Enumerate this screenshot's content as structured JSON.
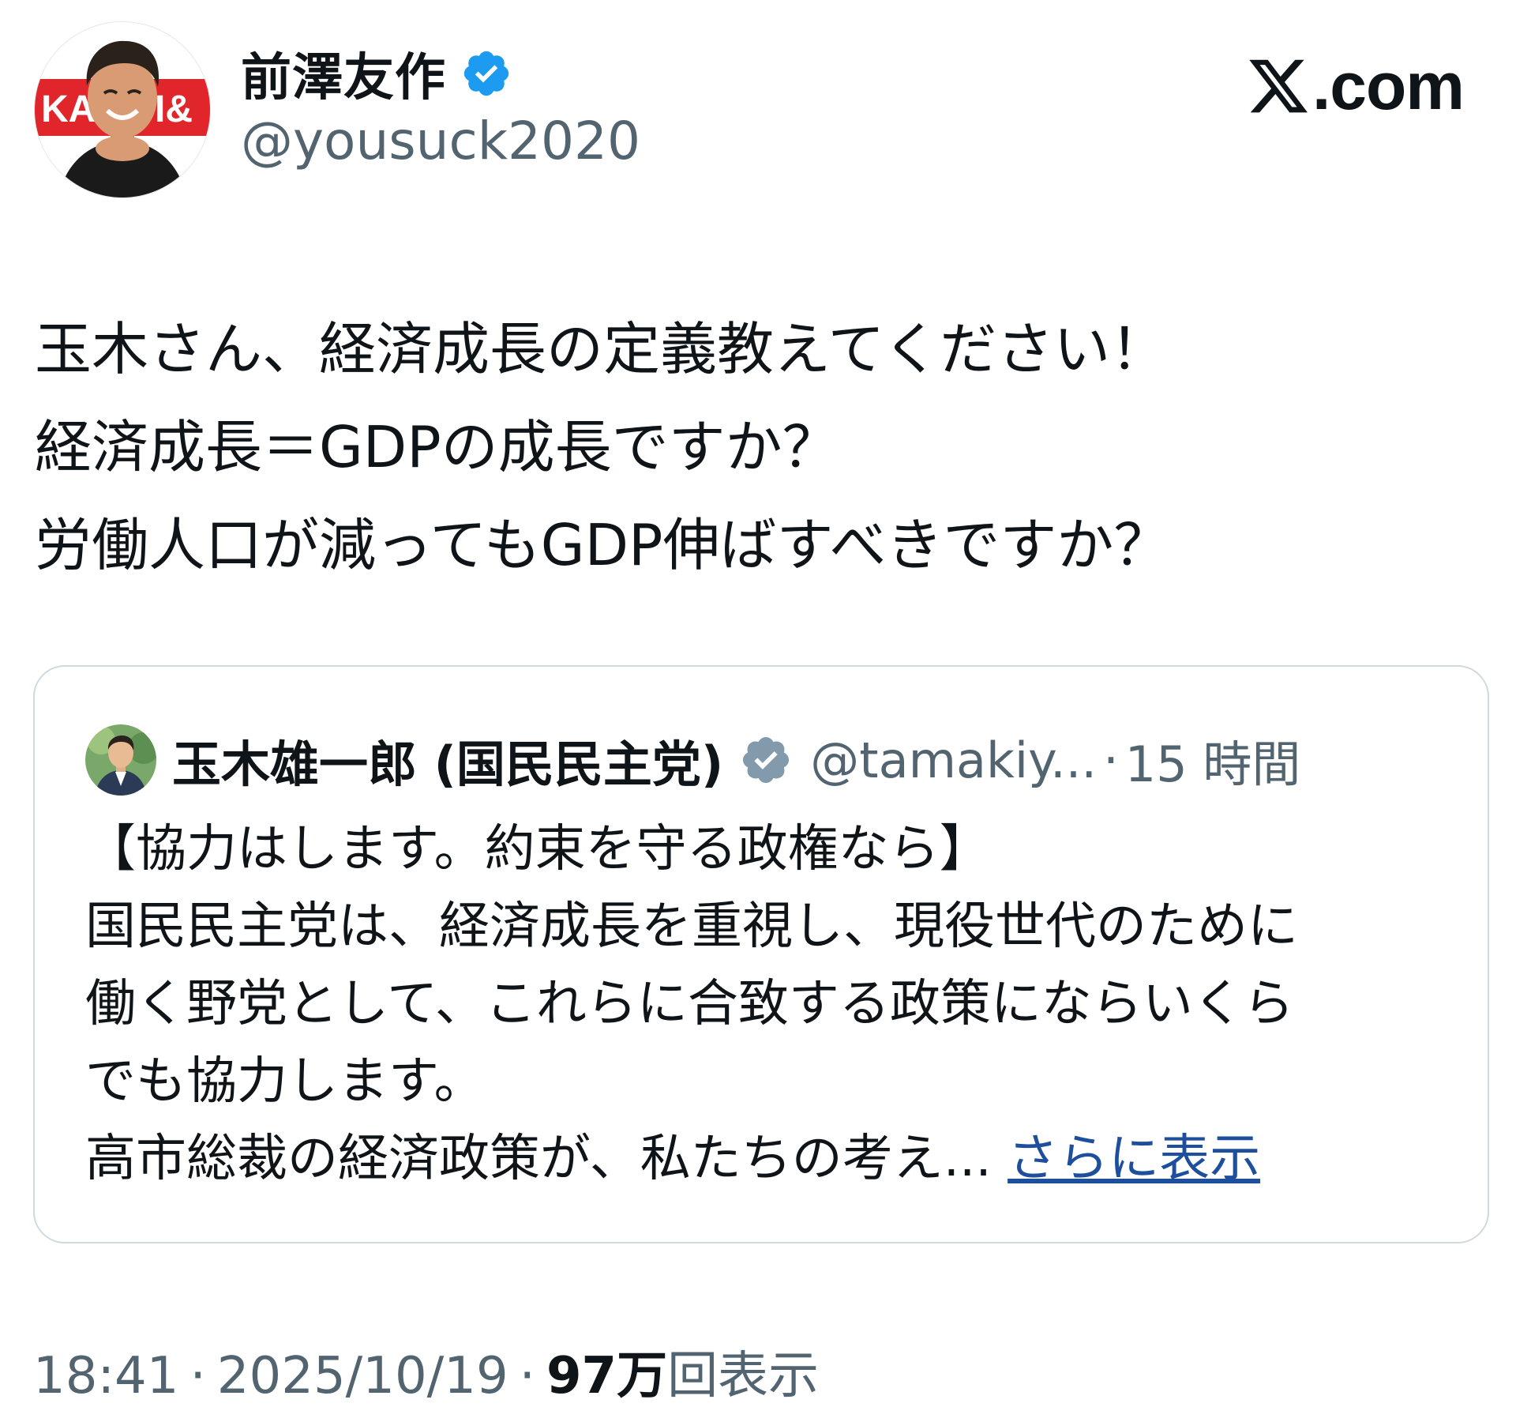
{
  "author": {
    "display_name": "前澤友作",
    "handle": "@yousuck2020",
    "avatar_sign_text": "KA  I&"
  },
  "brand": {
    "logo_text": ".com"
  },
  "tweet": {
    "lines": [
      "玉木さん、経済成長の定義教えてください！",
      "経済成長＝GDPの成長ですか？",
      "労働人口が減ってもGDP伸ばすべきですか？"
    ]
  },
  "quote": {
    "display_name": "玉木雄一郎 (国民民主党)",
    "handle": "@tamakiy...",
    "separator": "·",
    "time": "15 時間",
    "lines": [
      "【協力はします。約束を守る政権なら】",
      "国民民主党は、経済成長を重視し、現役世代のために",
      "働く野党として、これらに合致する政策にならいくら",
      "でも協力します。"
    ],
    "last_line": "高市総裁の経済政策が、私たちの考え...",
    "show_more": "さらに表示"
  },
  "footer": {
    "time": "18:41",
    "date": "2025/10/19",
    "views_count": "97万",
    "views_label": "回表示",
    "separator": "·"
  },
  "colors": {
    "text_primary": "#0f1419",
    "text_secondary": "#536471",
    "verified_blue": "#1d9bf0",
    "verified_gray": "#829aab",
    "link": "#1d4f9c",
    "border": "#cfd9de"
  },
  "icons": {
    "verified": "verified-badge-icon",
    "verified_gray": "verified-badge-gray-icon",
    "x_logo": "x-logo-icon"
  }
}
